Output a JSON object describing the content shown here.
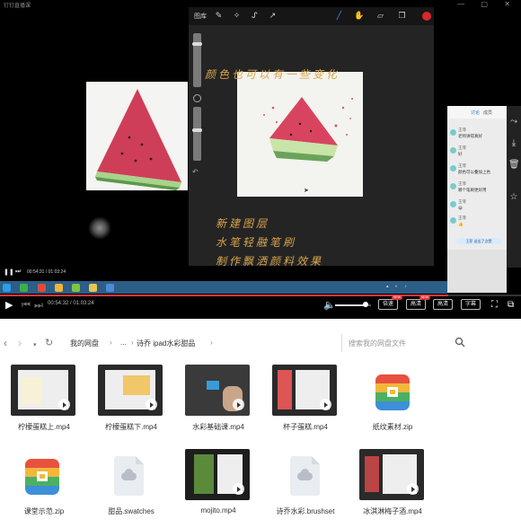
{
  "window": {
    "title": "钉钉直播课"
  },
  "procreate": {
    "toolbar_left_label": "图库",
    "handwriting_top": "颜色也可以有一些变化",
    "handwriting_lines": [
      "新建图层",
      "水笔轻融笔刷",
      "制作飘洒颜料效果"
    ]
  },
  "chat": {
    "tabs": [
      "讨论",
      "成员"
    ],
    "messages": [
      {
        "user": "王菲",
        "text": "老师讲得真好"
      },
      {
        "user": "王菲",
        "text": "好"
      },
      {
        "user": "王菲",
        "text": "颜色可以叠加上色"
      },
      {
        "user": "王菲",
        "text": "哪个笔刷更好用"
      },
      {
        "user": "王菲",
        "text": "😀"
      },
      {
        "user": "王菲",
        "text": "👍"
      }
    ],
    "banner": "王菲 送出了点赞"
  },
  "mini_player": {
    "time": "00:54:31 / 01:03:24"
  },
  "player": {
    "time": "00:54:32 / 01:03:24",
    "progress_fraction": 0.86,
    "volume_fraction": 0.85,
    "buttons": [
      {
        "label": "倍速",
        "badge": "NEW"
      },
      {
        "label": "高清",
        "badge": "NEW"
      },
      {
        "label": "高清",
        "badge": ""
      },
      {
        "label": "字幕",
        "badge": ""
      }
    ]
  },
  "drive": {
    "breadcrumbs": [
      "我的网盘",
      "...",
      "诗乔 ipad水彩甜品"
    ],
    "search_placeholder": "搜索我的网盘文件",
    "files": [
      {
        "name": "柠檬蛋糕上.mp4",
        "kind": "video"
      },
      {
        "name": "柠檬蛋糕下.mp4",
        "kind": "video"
      },
      {
        "name": "水彩基础课.mp4",
        "kind": "video"
      },
      {
        "name": "杯子蛋糕.mp4",
        "kind": "video"
      },
      {
        "name": "纸纹素材.zip",
        "kind": "zip"
      },
      {
        "name": "课堂示范.zip",
        "kind": "zip"
      },
      {
        "name": "甜品.swatches",
        "kind": "doc"
      },
      {
        "name": "mojito.mp4",
        "kind": "video"
      },
      {
        "name": "诗乔水彩.brushset",
        "kind": "doc"
      },
      {
        "name": "冰淇淋梅子酒.mp4",
        "kind": "video"
      }
    ]
  },
  "colors": {
    "accent_red": "#e2383a",
    "taskbar": "#2c5e88",
    "handwriting": "#d9a44a"
  }
}
